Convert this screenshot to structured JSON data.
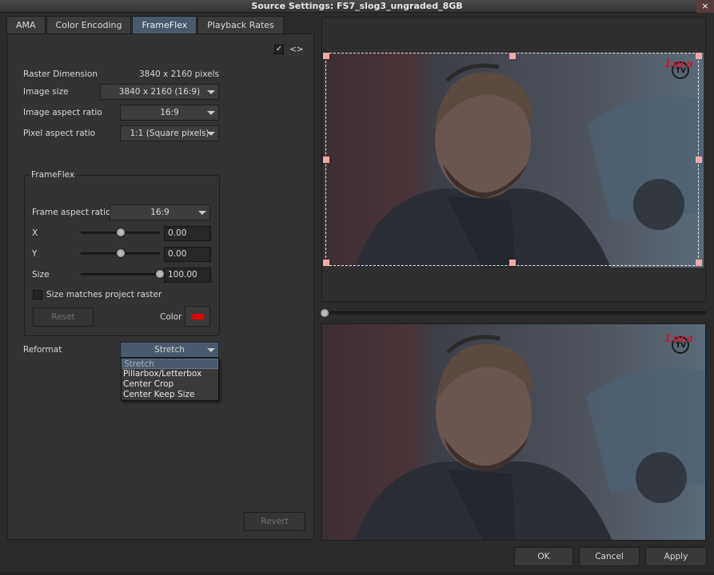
{
  "window": {
    "title": "Source Settings: FS7_slog3_ungraded_8GB",
    "close_label": "×"
  },
  "tabs": [
    {
      "label": "AMA",
      "active": false
    },
    {
      "label": "Color Encoding",
      "active": false
    },
    {
      "label": "FrameFlex",
      "active": true
    },
    {
      "label": "Playback Rates",
      "active": false
    }
  ],
  "top_toggle": {
    "checked": true,
    "checkmark": "✓",
    "label": "<>"
  },
  "raster": {
    "label": "Raster Dimension",
    "value": "3840 x 2160 pixels"
  },
  "image_size": {
    "label": "Image size",
    "value": "3840 x 2160 (16:9)"
  },
  "image_aspect": {
    "label": "Image aspect ratio",
    "value": "16:9"
  },
  "pixel_aspect": {
    "label": "Pixel aspect ratio",
    "value": "1:1 (Square pixels)"
  },
  "frameflex": {
    "group_title": "FrameFlex",
    "frame_aspect": {
      "label": "Frame aspect ratio",
      "value": "16:9"
    },
    "x": {
      "label": "X",
      "value": "0.00",
      "level": 0.5
    },
    "y": {
      "label": "Y",
      "value": "0.00",
      "level": 0.5
    },
    "size": {
      "label": "Size",
      "value": "100.00",
      "level": 1.0
    },
    "size_matches": {
      "label": "Size matches project raster",
      "checked": false
    },
    "reset_label": "Reset",
    "color_label": "Color",
    "color_value": "#e00000"
  },
  "reformat": {
    "label": "Reformat",
    "value": "Stretch",
    "options": [
      "Stretch",
      "Pillarbox/Letterbox",
      "Center Crop",
      "Center Keep Size"
    ],
    "highlighted": "Stretch"
  },
  "revert_label": "Revert",
  "viewer": {
    "logo_script": "Luca",
    "logo_tv": "TV"
  },
  "buttons": {
    "ok": "OK",
    "cancel": "Cancel",
    "apply": "Apply"
  },
  "colors": {
    "accent": "#4a5a6c",
    "panel": "#333333",
    "crop_handle": "#f0a8a8"
  }
}
